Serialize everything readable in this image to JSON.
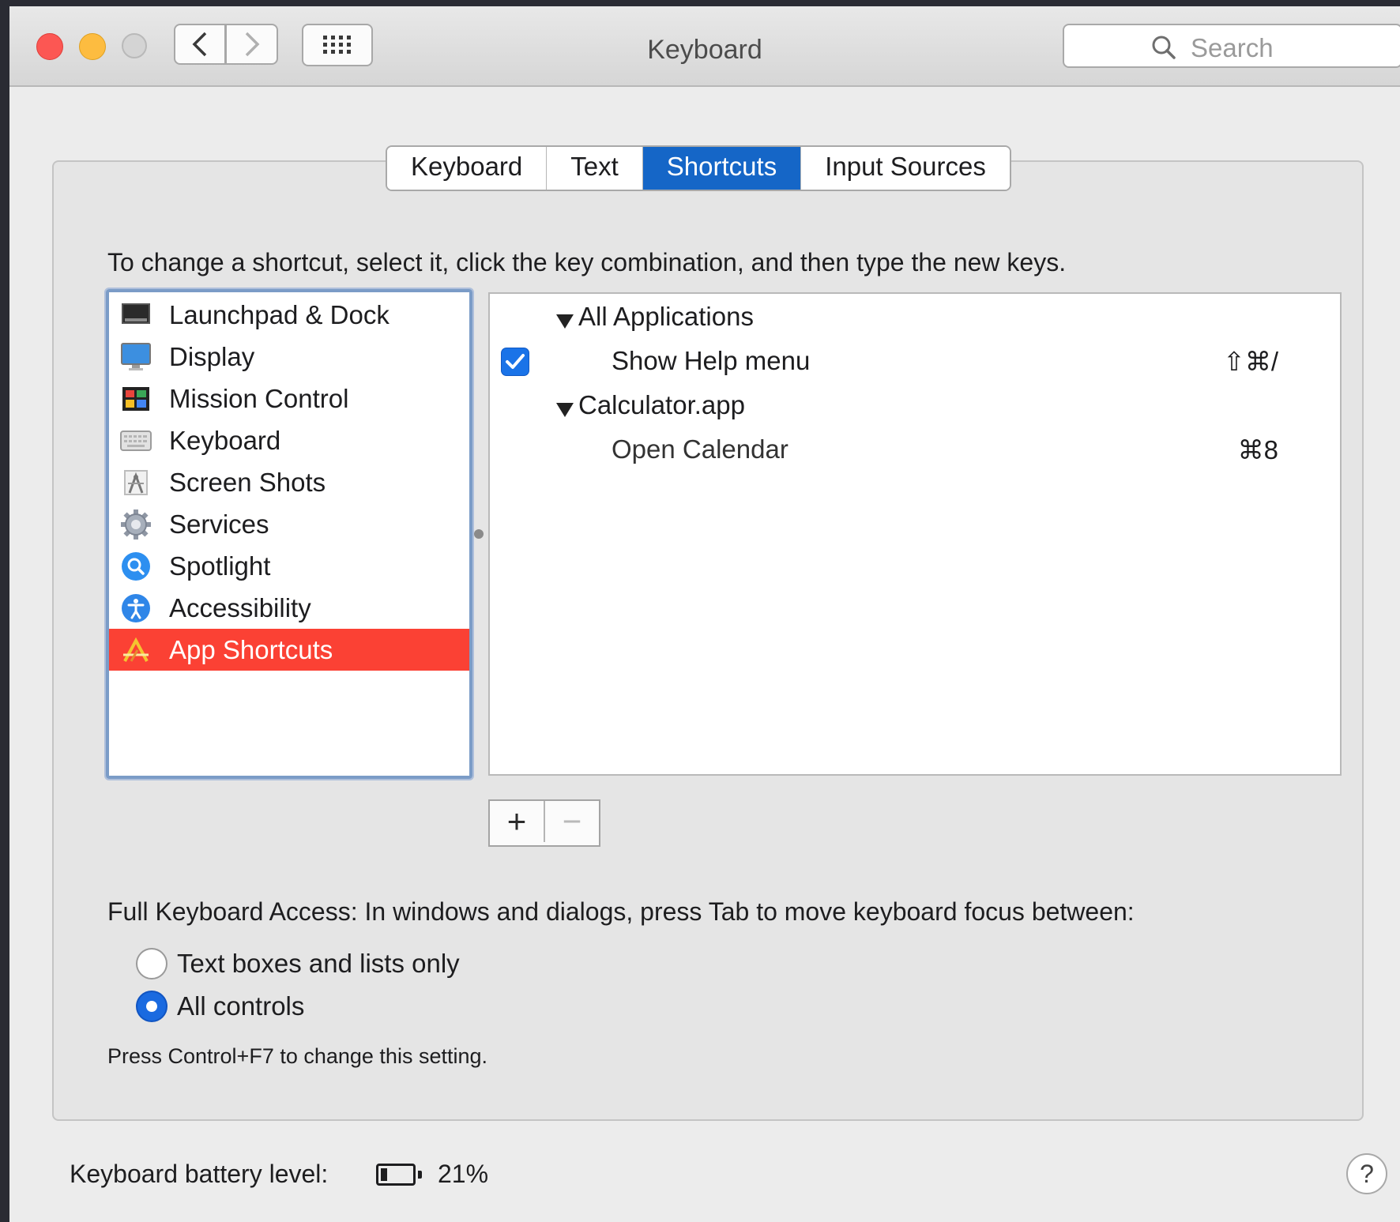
{
  "window": {
    "title": "Keyboard"
  },
  "search": {
    "placeholder": "Search"
  },
  "tabs": [
    {
      "label": "Keyboard",
      "active": false
    },
    {
      "label": "Text",
      "active": false
    },
    {
      "label": "Shortcuts",
      "active": true
    },
    {
      "label": "Input Sources",
      "active": false
    }
  ],
  "instructions": "To change a shortcut, select it, click the key combination, and then type the new keys.",
  "categories": [
    {
      "label": "Launchpad & Dock",
      "icon": "launchpad-dock-icon"
    },
    {
      "label": "Display",
      "icon": "display-icon"
    },
    {
      "label": "Mission Control",
      "icon": "mission-control-icon"
    },
    {
      "label": "Keyboard",
      "icon": "keyboard-icon"
    },
    {
      "label": "Screen Shots",
      "icon": "screenshot-icon"
    },
    {
      "label": "Services",
      "icon": "gear-icon"
    },
    {
      "label": "Spotlight",
      "icon": "spotlight-icon"
    },
    {
      "label": "Accessibility",
      "icon": "accessibility-icon"
    },
    {
      "label": "App Shortcuts",
      "icon": "app-store-icon",
      "selected": true
    }
  ],
  "shortcuts": {
    "groups": [
      {
        "label": "All Applications",
        "items": [
          {
            "label": "Show Help menu",
            "keys": "⇧⌘/",
            "checked": true
          }
        ]
      },
      {
        "label": "Calculator.app",
        "items": [
          {
            "label": "Open Calendar",
            "keys": "⌘8"
          }
        ]
      }
    ]
  },
  "buttons": {
    "add": "+",
    "remove": "−"
  },
  "full_keyboard_access": {
    "description": "Full Keyboard Access: In windows and dialogs, press Tab to move keyboard focus between:",
    "options": [
      {
        "label": "Text boxes and lists only",
        "selected": false
      },
      {
        "label": "All controls",
        "selected": true
      }
    ],
    "hint": "Press Control+F7 to change this setting."
  },
  "battery": {
    "label": "Keyboard battery level:",
    "percent_text": "21%",
    "level": 0.21
  },
  "help": {
    "label": "?"
  },
  "colors": {
    "accent": "#1566c7",
    "selection": "#fb4134",
    "close": "#fc5753",
    "minimize": "#fdbc40"
  }
}
